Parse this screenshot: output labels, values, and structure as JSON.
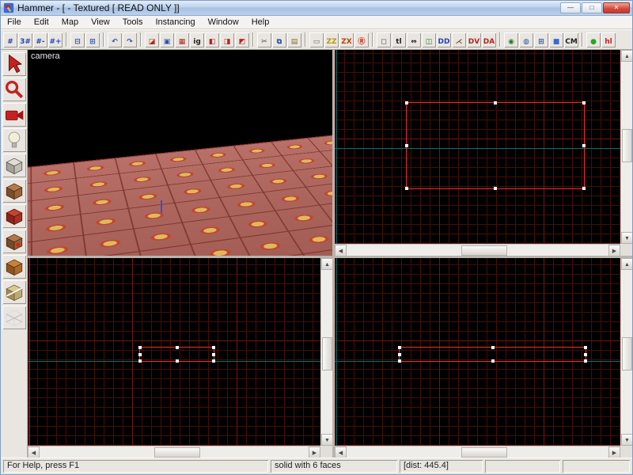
{
  "window": {
    "title": "Hammer - [ - Textured [ READ ONLY ]]",
    "app_icon": "hammer-icon",
    "controls": {
      "minimize": "—",
      "maximize": "□",
      "close": "✕"
    }
  },
  "menu": {
    "items": [
      {
        "label": "File"
      },
      {
        "label": "Edit"
      },
      {
        "label": "Map"
      },
      {
        "label": "View"
      },
      {
        "label": "Tools"
      },
      {
        "label": "Instancing"
      },
      {
        "label": "Window"
      },
      {
        "label": "Help"
      }
    ]
  },
  "toolbar": {
    "items": [
      {
        "name": "toggle-grid-icon",
        "glyph": "#",
        "fg": "#2244bb"
      },
      {
        "name": "toggle-3d-grid-icon",
        "glyph": "3#",
        "fg": "#2244bb"
      },
      {
        "name": "smaller-grid-icon",
        "glyph": "#-",
        "fg": "#2244bb"
      },
      {
        "name": "larger-grid-icon",
        "glyph": "#+",
        "fg": "#2244bb"
      },
      {
        "sep": true
      },
      {
        "name": "load-window-state-icon",
        "glyph": "⊟",
        "fg": "#2a52a8"
      },
      {
        "name": "save-window-state-icon",
        "glyph": "⊞",
        "fg": "#2a52a8"
      },
      {
        "sep": true
      },
      {
        "name": "undo-icon",
        "glyph": "↶",
        "fg": "#2a52a8"
      },
      {
        "name": "redo-icon",
        "glyph": "↷",
        "fg": "#2a52a8"
      },
      {
        "sep": true
      },
      {
        "name": "carve-icon",
        "glyph": "◪",
        "fg": "#b02820"
      },
      {
        "name": "group-icon",
        "glyph": "▣",
        "fg": "#2a52a8"
      },
      {
        "name": "ungroup-icon",
        "glyph": "▦",
        "fg": "#b02820"
      },
      {
        "name": "ignore-groups-icon",
        "glyph": "ig",
        "fg": "#222222"
      },
      {
        "name": "hide-selected-icon",
        "glyph": "◧",
        "fg": "#b02820"
      },
      {
        "name": "hide-unselected-icon",
        "glyph": "◨",
        "fg": "#b02820"
      },
      {
        "name": "show-hidden-icon",
        "glyph": "◩",
        "fg": "#b02820"
      },
      {
        "sep": true
      },
      {
        "name": "cut-icon",
        "glyph": "✂",
        "fg": "#444444"
      },
      {
        "name": "copy-icon",
        "glyph": "⧉",
        "fg": "#2a52a8"
      },
      {
        "name": "paste-icon",
        "glyph": "▤",
        "fg": "#8a6a30"
      },
      {
        "sep": true
      },
      {
        "name": "cordon-icon",
        "glyph": "▭",
        "fg": "#666666"
      },
      {
        "name": "cordon-edit-icon",
        "glyph": "ZZ",
        "fg": "#bb9900"
      },
      {
        "name": "cordon-active-icon",
        "glyph": "ZX",
        "fg": "#bb4400"
      },
      {
        "name": "radius-culling-icon",
        "glyph": "Ⓡ",
        "fg": "#bb2200"
      },
      {
        "sep": true
      },
      {
        "name": "select-touching-icon",
        "glyph": "◻",
        "fg": "#444444"
      },
      {
        "name": "texture-lock-icon",
        "glyph": "tl",
        "fg": "#222222"
      },
      {
        "name": "texture-scale-lock-icon",
        "glyph": "⇔",
        "fg": "#222222"
      },
      {
        "name": "flip-faces-icon",
        "glyph": "◫",
        "fg": "#2a7a2a"
      },
      {
        "name": "display-detail-icon",
        "glyph": "DD",
        "fg": "#2244bb"
      },
      {
        "name": "helpers-icon",
        "glyph": "⋌",
        "fg": "#884422"
      },
      {
        "name": "display-wire-icon",
        "glyph": "DV",
        "fg": "#b02820"
      },
      {
        "name": "display-alpha-icon",
        "glyph": "DA",
        "fg": "#b02820"
      },
      {
        "sep": true
      },
      {
        "name": "toggle-models-icon",
        "glyph": "◉",
        "fg": "#2a7a2a"
      },
      {
        "name": "model-fade-icon",
        "glyph": "◍",
        "fg": "#2a52a8"
      },
      {
        "name": "displacement-mask-icon",
        "glyph": "⊞",
        "fg": "#2a52a8"
      },
      {
        "name": "entity-report-icon",
        "glyph": "■",
        "fg": "#3a6ad0"
      },
      {
        "name": "check-map-icon",
        "glyph": "CM",
        "fg": "#222222"
      },
      {
        "sep": true
      },
      {
        "name": "run-map-icon",
        "glyph": "●",
        "fg": "#22aa22"
      },
      {
        "name": "help-topics-icon",
        "glyph": "hl",
        "fg": "#cc2222"
      }
    ]
  },
  "palette": {
    "tools": [
      "selection-tool-icon",
      "magnify-tool-icon",
      "camera-tool-icon",
      "entity-tool-icon",
      "block-tool-icon",
      "texture-application-tool-icon",
      "apply-current-texture-tool-icon",
      "apply-decals-tool-icon",
      "overlay-tool-icon",
      "clipping-tool-icon",
      "vertex-manipulation-tool-icon"
    ]
  },
  "icons": {
    "scroll_up": "▲",
    "scroll_down": "▼",
    "scroll_left": "◀",
    "scroll_right": "▶"
  },
  "viewports": {
    "camera_label": "camera"
  },
  "statusbar": {
    "help": "For Help, press F1",
    "brush_info": "solid with 6 faces",
    "distance": "[dist: 445.4]"
  },
  "colors": {
    "grid_line": "#470c0c",
    "grid_major": "#741515",
    "axis": "#0e6e6e",
    "selection": "#ee3228",
    "titlebar": "#bcd0ea",
    "viewport_bg": "#000000"
  }
}
